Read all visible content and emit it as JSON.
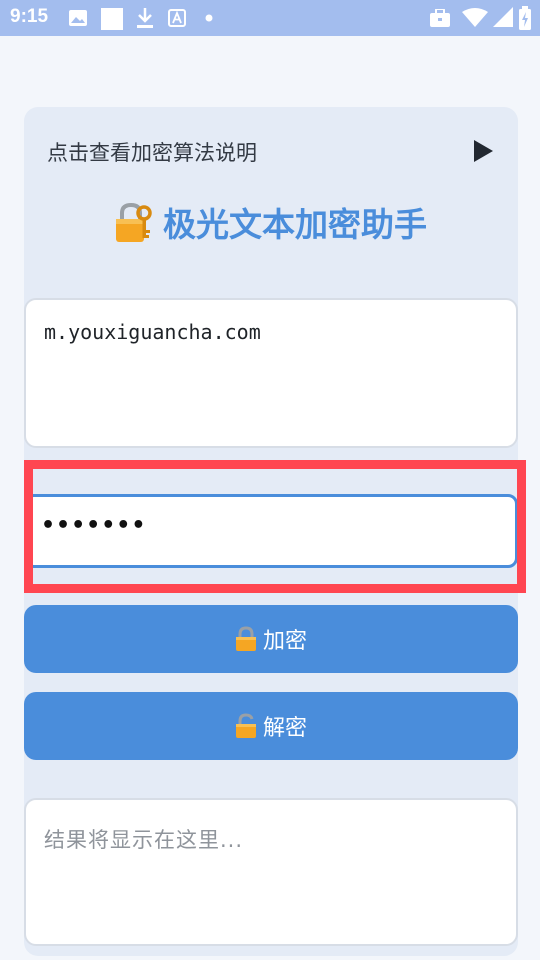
{
  "status_bar": {
    "time": "9:15",
    "icons_left": [
      "image-icon",
      "square-icon",
      "download-icon",
      "font-icon",
      "dot-icon"
    ],
    "icons_right": [
      "briefcase-icon",
      "wifi-icon",
      "signal-icon",
      "battery-icon"
    ]
  },
  "description_toggle": {
    "label": "点击查看加密算法说明",
    "icon": "play-icon"
  },
  "header": {
    "title": "极光文本加密助手",
    "icon": "lock-key-icon"
  },
  "input": {
    "value": "m.youxiguancha.com"
  },
  "password": {
    "value": "•••••••"
  },
  "buttons": {
    "encrypt_label": "加密",
    "decrypt_label": "解密"
  },
  "result": {
    "placeholder": "结果将显示在这里..."
  },
  "colors": {
    "accent": "#4a8ddb",
    "status_bar": "#a3bdee",
    "card": "#e4ebf6",
    "highlight": "#ff4651"
  }
}
